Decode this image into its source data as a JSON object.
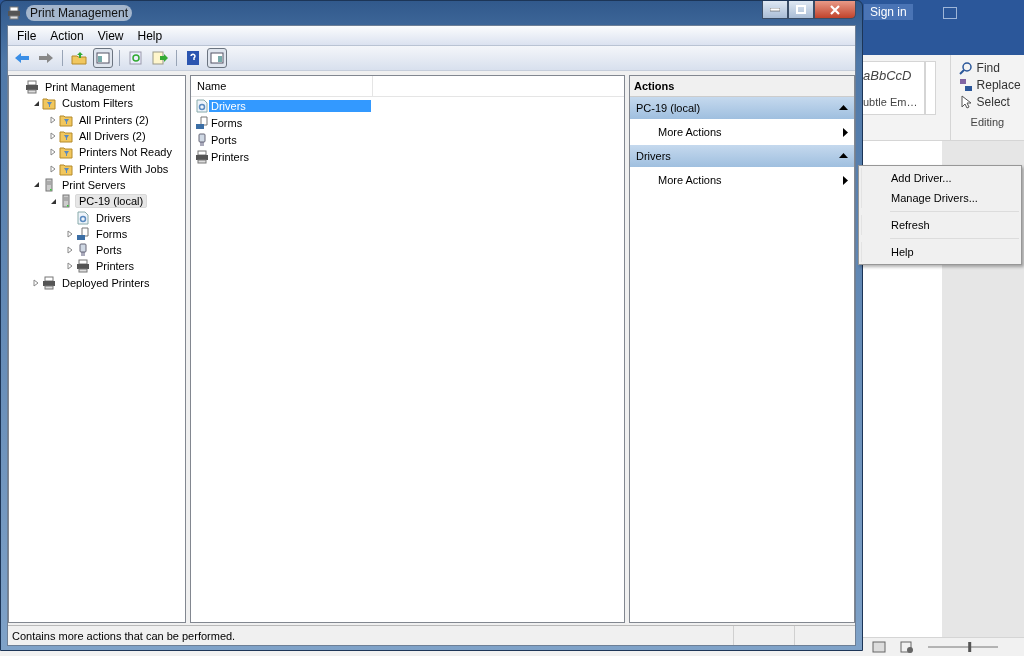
{
  "background_app": {
    "sign_in": "Sign in",
    "styles": [
      {
        "label": "aBbCcD"
      },
      {
        "label": "ubtle Em…"
      }
    ],
    "editing": {
      "items": [
        {
          "kind": "find",
          "label": "Find"
        },
        {
          "kind": "replace",
          "label": "Replace"
        },
        {
          "kind": "select",
          "label": "Select"
        }
      ],
      "group_label": "Editing"
    },
    "zoom": {
      "level": 0.6
    }
  },
  "window": {
    "title": "Print Management"
  },
  "menu": [
    "File",
    "Action",
    "View",
    "Help"
  ],
  "tree": [
    {
      "kind": "root",
      "label": "Print Management",
      "selected": false,
      "children": [
        {
          "kind": "filter-folder",
          "label": "Custom Filters",
          "expanded": true,
          "selected": false,
          "children": [
            {
              "kind": "filter",
              "label": "All Printers (2)",
              "expanded": false,
              "selected": false
            },
            {
              "kind": "filter",
              "label": "All Drivers (2)",
              "expanded": false,
              "selected": false
            },
            {
              "kind": "filter",
              "label": "Printers Not Ready",
              "expanded": false,
              "selected": false
            },
            {
              "kind": "filter",
              "label": "Printers With Jobs",
              "expanded": false,
              "selected": false
            }
          ]
        },
        {
          "kind": "server",
          "label": "Print Servers",
          "expanded": true,
          "selected": false,
          "children": [
            {
              "kind": "server",
              "label": "PC-19 (local)",
              "expanded": true,
              "selected": true,
              "children": [
                {
                  "kind": "drivers",
                  "label": "Drivers",
                  "selected": false
                },
                {
                  "kind": "forms",
                  "label": "Forms",
                  "expanded": false,
                  "selected": false
                },
                {
                  "kind": "ports",
                  "label": "Ports",
                  "expanded": false,
                  "selected": false
                },
                {
                  "kind": "printers",
                  "label": "Printers",
                  "expanded": false,
                  "selected": false
                }
              ]
            }
          ]
        },
        {
          "kind": "printers",
          "label": "Deployed Printers",
          "expanded": false,
          "selected": false
        }
      ]
    }
  ],
  "list": {
    "columns": [
      "Name"
    ],
    "rows": [
      {
        "kind": "drivers",
        "name": "Drivers",
        "selected": true
      },
      {
        "kind": "forms",
        "name": "Forms",
        "selected": false
      },
      {
        "kind": "ports",
        "name": "Ports",
        "selected": false
      },
      {
        "kind": "printers",
        "name": "Printers",
        "selected": false
      }
    ]
  },
  "actions": {
    "title": "Actions",
    "sections": [
      {
        "title": "PC-19 (local)",
        "expanded": true,
        "items": [
          "More Actions"
        ]
      },
      {
        "title": "Drivers",
        "expanded": true,
        "items": [
          "More Actions"
        ]
      }
    ]
  },
  "context_menu": [
    [
      "Add Driver...",
      "Manage Drivers..."
    ],
    [
      "Refresh"
    ],
    [
      "Help"
    ]
  ],
  "status_bar": "Contains more actions that can be performed."
}
